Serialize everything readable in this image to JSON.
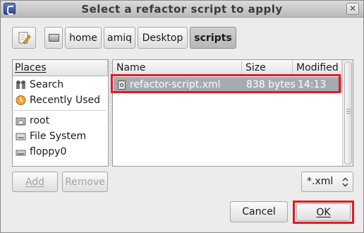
{
  "window": {
    "title": "Select a refactor script to apply"
  },
  "breadcrumbs": [
    "home",
    "amiq",
    "Desktop",
    "scripts"
  ],
  "places": {
    "header": "Places",
    "items": [
      {
        "label": "Search",
        "icon": "search-icon"
      },
      {
        "label": "Recently Used",
        "icon": "recent-icon"
      },
      {
        "label": "root",
        "icon": "home-folder-icon"
      },
      {
        "label": "File System",
        "icon": "drive-icon"
      },
      {
        "label": "floppy0",
        "icon": "floppy-icon"
      }
    ]
  },
  "files": {
    "columns": [
      "Name",
      "Size",
      "Modified"
    ],
    "rows": [
      {
        "name": "refactor-script.xml",
        "size": "838 bytes",
        "modified": "14:13",
        "selected": true
      }
    ]
  },
  "buttons": {
    "add": "Add",
    "remove": "Remove",
    "cancel": "Cancel",
    "ok": "OK"
  },
  "filter": {
    "value": "*.xml"
  },
  "colors": {
    "highlight": "#e01b24",
    "selection": "#a6aab2"
  }
}
